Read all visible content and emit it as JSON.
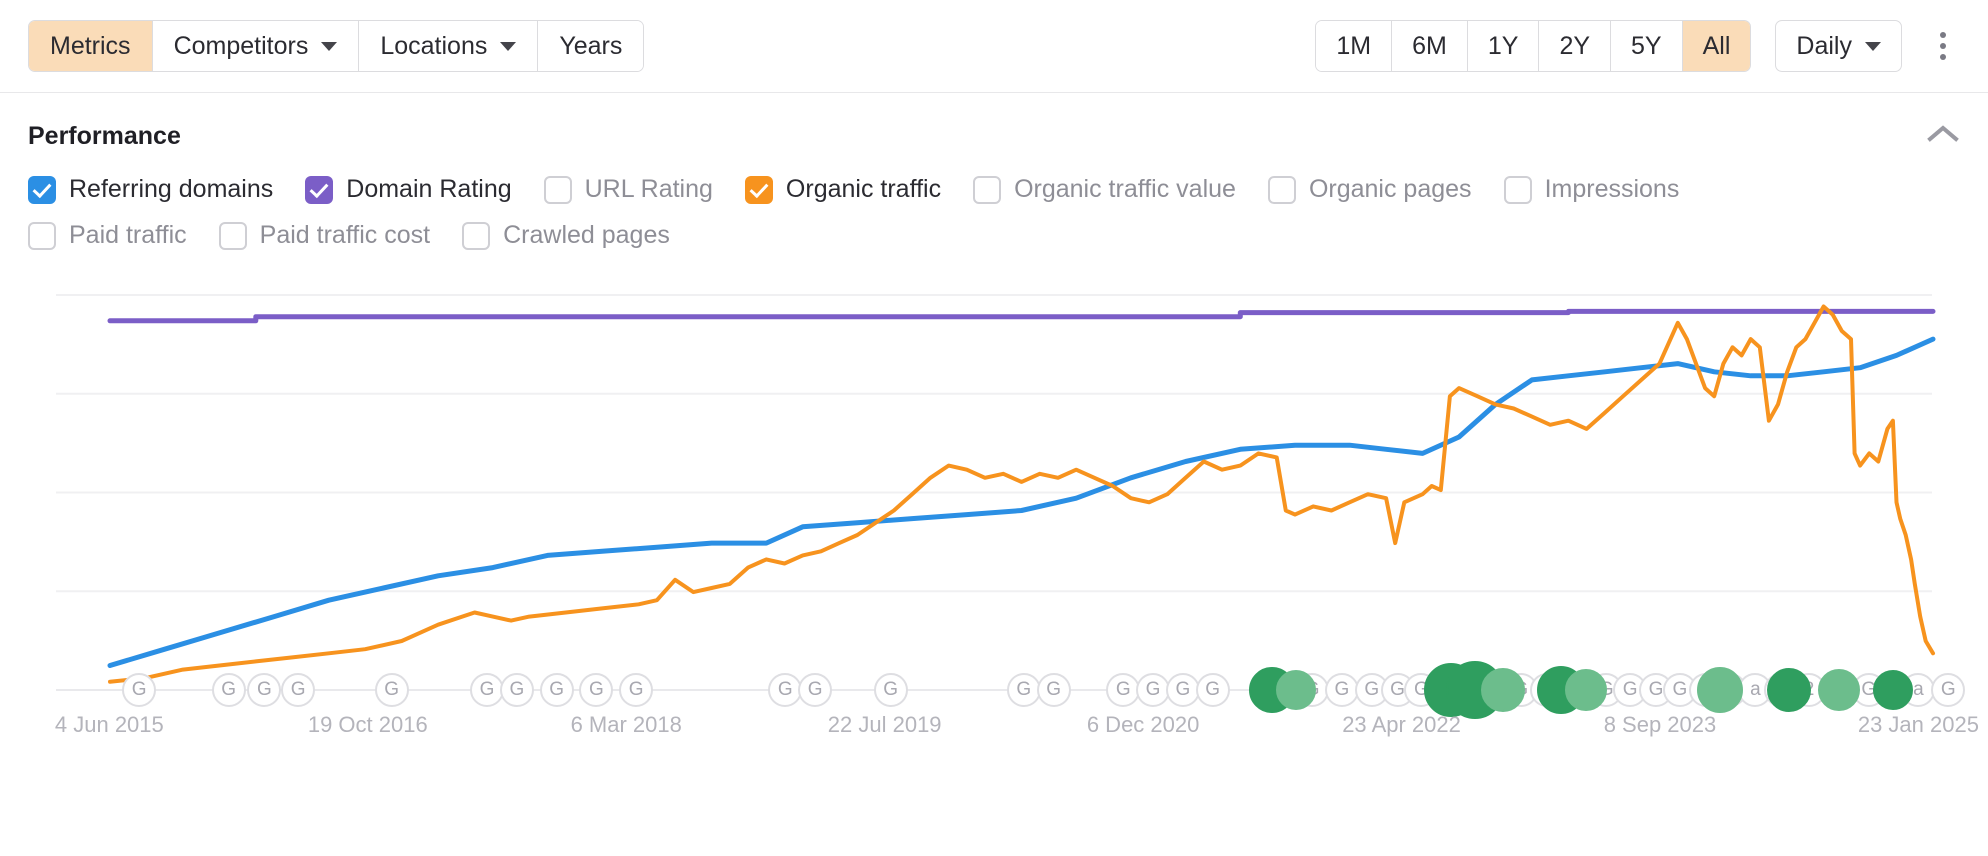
{
  "toolbar": {
    "tabs": [
      {
        "label": "Metrics",
        "active": true,
        "caret": false
      },
      {
        "label": "Competitors",
        "active": false,
        "caret": true
      },
      {
        "label": "Locations",
        "active": false,
        "caret": true
      },
      {
        "label": "Years",
        "active": false,
        "caret": false
      }
    ],
    "ranges": [
      {
        "label": "1M",
        "active": false
      },
      {
        "label": "6M",
        "active": false
      },
      {
        "label": "1Y",
        "active": false
      },
      {
        "label": "2Y",
        "active": false
      },
      {
        "label": "5Y",
        "active": false
      },
      {
        "label": "All",
        "active": true
      }
    ],
    "granularity": "Daily",
    "more_menu": "more-options"
  },
  "section": {
    "title": "Performance",
    "collapse": "collapse"
  },
  "metrics": {
    "row1": [
      {
        "label": "Referring domains",
        "checked": true,
        "color": "#2b8fe4"
      },
      {
        "label": "Domain Rating",
        "checked": true,
        "color": "#7b5ec7"
      },
      {
        "label": "URL Rating",
        "checked": false,
        "color": "#cfcfd4"
      },
      {
        "label": "Organic traffic",
        "checked": true,
        "color": "#f7931e"
      },
      {
        "label": "Organic traffic value",
        "checked": false,
        "color": "#cfcfd4"
      },
      {
        "label": "Organic pages",
        "checked": false,
        "color": "#cfcfd4"
      },
      {
        "label": "Impressions",
        "checked": false,
        "color": "#cfcfd4"
      }
    ],
    "row2": [
      {
        "label": "Paid traffic",
        "checked": false,
        "color": "#cfcfd4"
      },
      {
        "label": "Paid traffic cost",
        "checked": false,
        "color": "#cfcfd4"
      },
      {
        "label": "Crawled pages",
        "checked": false,
        "color": "#cfcfd4"
      }
    ]
  },
  "chart_data": {
    "type": "line",
    "title": "Performance",
    "xlabel": "",
    "ylabel": "",
    "grid": true,
    "legend": "top-checkboxes",
    "x_tick_labels": [
      "4 Jun 2015",
      "19 Oct 2016",
      "6 Mar 2018",
      "22 Jul 2019",
      "6 Dec 2020",
      "23 Apr 2022",
      "8 Sep 2023",
      "23 Jan 2025"
    ],
    "x_tick_positions_pct": [
      5.5,
      18.5,
      31.5,
      44.5,
      57.5,
      70.5,
      83.5,
      96.5
    ],
    "x_range": [
      "2015-06-04",
      "2025-01-23"
    ],
    "gridline_count": 5,
    "series": [
      {
        "name": "Referring domains",
        "color": "#2b8fe4",
        "unit": "domains",
        "points": [
          [
            0.0,
            0.06
          ],
          [
            0.03,
            0.1
          ],
          [
            0.06,
            0.14
          ],
          [
            0.09,
            0.18
          ],
          [
            0.12,
            0.22
          ],
          [
            0.15,
            0.25
          ],
          [
            0.18,
            0.28
          ],
          [
            0.21,
            0.3
          ],
          [
            0.24,
            0.33
          ],
          [
            0.27,
            0.34
          ],
          [
            0.3,
            0.35
          ],
          [
            0.33,
            0.36
          ],
          [
            0.36,
            0.36
          ],
          [
            0.38,
            0.4
          ],
          [
            0.41,
            0.41
          ],
          [
            0.44,
            0.42
          ],
          [
            0.47,
            0.43
          ],
          [
            0.5,
            0.44
          ],
          [
            0.53,
            0.47
          ],
          [
            0.56,
            0.52
          ],
          [
            0.59,
            0.56
          ],
          [
            0.62,
            0.59
          ],
          [
            0.65,
            0.6
          ],
          [
            0.68,
            0.6
          ],
          [
            0.7,
            0.59
          ],
          [
            0.72,
            0.58
          ],
          [
            0.74,
            0.62
          ],
          [
            0.76,
            0.7
          ],
          [
            0.78,
            0.76
          ],
          [
            0.8,
            0.77
          ],
          [
            0.82,
            0.78
          ],
          [
            0.84,
            0.79
          ],
          [
            0.86,
            0.8
          ],
          [
            0.88,
            0.78
          ],
          [
            0.9,
            0.77
          ],
          [
            0.92,
            0.77
          ],
          [
            0.94,
            0.78
          ],
          [
            0.96,
            0.79
          ],
          [
            0.98,
            0.82
          ],
          [
            1.0,
            0.86
          ]
        ]
      },
      {
        "name": "Domain Rating",
        "color": "#7b5ec7",
        "unit": "DR",
        "step": true,
        "points": [
          [
            0.0,
            0.905
          ],
          [
            0.08,
            0.905
          ],
          [
            0.08,
            0.915
          ],
          [
            0.62,
            0.915
          ],
          [
            0.62,
            0.925
          ],
          [
            0.8,
            0.925
          ],
          [
            0.8,
            0.928
          ],
          [
            1.0,
            0.928
          ]
        ]
      },
      {
        "name": "Organic traffic",
        "color": "#f7931e",
        "unit": "visits/mo",
        "points": [
          [
            0.0,
            0.02
          ],
          [
            0.02,
            0.03
          ],
          [
            0.04,
            0.05
          ],
          [
            0.06,
            0.06
          ],
          [
            0.08,
            0.07
          ],
          [
            0.1,
            0.08
          ],
          [
            0.12,
            0.09
          ],
          [
            0.14,
            0.1
          ],
          [
            0.16,
            0.12
          ],
          [
            0.18,
            0.16
          ],
          [
            0.2,
            0.19
          ],
          [
            0.21,
            0.18
          ],
          [
            0.22,
            0.17
          ],
          [
            0.23,
            0.18
          ],
          [
            0.25,
            0.19
          ],
          [
            0.27,
            0.2
          ],
          [
            0.29,
            0.21
          ],
          [
            0.3,
            0.22
          ],
          [
            0.31,
            0.27
          ],
          [
            0.32,
            0.24
          ],
          [
            0.33,
            0.25
          ],
          [
            0.34,
            0.26
          ],
          [
            0.35,
            0.3
          ],
          [
            0.36,
            0.32
          ],
          [
            0.37,
            0.31
          ],
          [
            0.38,
            0.33
          ],
          [
            0.39,
            0.34
          ],
          [
            0.4,
            0.36
          ],
          [
            0.41,
            0.38
          ],
          [
            0.42,
            0.41
          ],
          [
            0.43,
            0.44
          ],
          [
            0.44,
            0.48
          ],
          [
            0.45,
            0.52
          ],
          [
            0.46,
            0.55
          ],
          [
            0.47,
            0.54
          ],
          [
            0.48,
            0.52
          ],
          [
            0.49,
            0.53
          ],
          [
            0.5,
            0.51
          ],
          [
            0.51,
            0.53
          ],
          [
            0.52,
            0.52
          ],
          [
            0.53,
            0.54
          ],
          [
            0.54,
            0.52
          ],
          [
            0.55,
            0.5
          ],
          [
            0.56,
            0.47
          ],
          [
            0.57,
            0.46
          ],
          [
            0.58,
            0.48
          ],
          [
            0.59,
            0.52
          ],
          [
            0.6,
            0.56
          ],
          [
            0.61,
            0.54
          ],
          [
            0.62,
            0.55
          ],
          [
            0.63,
            0.58
          ],
          [
            0.64,
            0.57
          ],
          [
            0.645,
            0.44
          ],
          [
            0.65,
            0.43
          ],
          [
            0.66,
            0.45
          ],
          [
            0.67,
            0.44
          ],
          [
            0.68,
            0.46
          ],
          [
            0.69,
            0.48
          ],
          [
            0.7,
            0.47
          ],
          [
            0.705,
            0.36
          ],
          [
            0.71,
            0.46
          ],
          [
            0.72,
            0.48
          ],
          [
            0.725,
            0.5
          ],
          [
            0.73,
            0.49
          ],
          [
            0.735,
            0.72
          ],
          [
            0.74,
            0.74
          ],
          [
            0.75,
            0.72
          ],
          [
            0.76,
            0.7
          ],
          [
            0.77,
            0.69
          ],
          [
            0.78,
            0.67
          ],
          [
            0.79,
            0.65
          ],
          [
            0.8,
            0.66
          ],
          [
            0.81,
            0.64
          ],
          [
            0.82,
            0.68
          ],
          [
            0.83,
            0.72
          ],
          [
            0.84,
            0.76
          ],
          [
            0.85,
            0.8
          ],
          [
            0.86,
            0.9
          ],
          [
            0.865,
            0.86
          ],
          [
            0.87,
            0.8
          ],
          [
            0.875,
            0.74
          ],
          [
            0.88,
            0.72
          ],
          [
            0.885,
            0.8
          ],
          [
            0.89,
            0.84
          ],
          [
            0.895,
            0.82
          ],
          [
            0.9,
            0.86
          ],
          [
            0.905,
            0.84
          ],
          [
            0.91,
            0.66
          ],
          [
            0.915,
            0.7
          ],
          [
            0.92,
            0.78
          ],
          [
            0.925,
            0.84
          ],
          [
            0.93,
            0.86
          ],
          [
            0.935,
            0.9
          ],
          [
            0.94,
            0.94
          ],
          [
            0.945,
            0.92
          ],
          [
            0.95,
            0.88
          ],
          [
            0.955,
            0.86
          ],
          [
            0.957,
            0.58
          ],
          [
            0.96,
            0.55
          ],
          [
            0.965,
            0.58
          ],
          [
            0.97,
            0.56
          ],
          [
            0.975,
            0.64
          ],
          [
            0.978,
            0.66
          ],
          [
            0.98,
            0.46
          ],
          [
            0.982,
            0.42
          ],
          [
            0.985,
            0.38
          ],
          [
            0.988,
            0.32
          ],
          [
            0.99,
            0.26
          ],
          [
            0.993,
            0.18
          ],
          [
            0.996,
            0.12
          ],
          [
            1.0,
            0.09
          ]
        ]
      }
    ],
    "event_markers": {
      "description": "Google algorithm update badges on the x-axis baseline",
      "items": [
        {
          "x": 7.0,
          "glyph": "G",
          "style": "gray",
          "size": 34
        },
        {
          "x": 11.5,
          "glyph": "G",
          "style": "gray",
          "size": 34
        },
        {
          "x": 13.3,
          "glyph": "G",
          "style": "gray",
          "size": 34
        },
        {
          "x": 15.0,
          "glyph": "G",
          "style": "gray",
          "size": 34
        },
        {
          "x": 19.7,
          "glyph": "G",
          "style": "gray",
          "size": 34
        },
        {
          "x": 24.5,
          "glyph": "G",
          "style": "gray",
          "size": 34
        },
        {
          "x": 26.0,
          "glyph": "G",
          "style": "gray",
          "size": 34
        },
        {
          "x": 28.0,
          "glyph": "G",
          "style": "gray",
          "size": 34
        },
        {
          "x": 30.0,
          "glyph": "G",
          "style": "gray",
          "size": 34
        },
        {
          "x": 32.0,
          "glyph": "G",
          "style": "gray",
          "size": 34
        },
        {
          "x": 39.5,
          "glyph": "G",
          "style": "gray",
          "size": 34
        },
        {
          "x": 41.0,
          "glyph": "G",
          "style": "gray",
          "size": 34
        },
        {
          "x": 44.8,
          "glyph": "G",
          "style": "gray",
          "size": 34
        },
        {
          "x": 51.5,
          "glyph": "G",
          "style": "gray",
          "size": 34
        },
        {
          "x": 53.0,
          "glyph": "G",
          "style": "gray",
          "size": 34
        },
        {
          "x": 56.5,
          "glyph": "G",
          "style": "gray",
          "size": 34
        },
        {
          "x": 58.0,
          "glyph": "G",
          "style": "gray",
          "size": 34
        },
        {
          "x": 59.5,
          "glyph": "G",
          "style": "gray",
          "size": 34
        },
        {
          "x": 61.0,
          "glyph": "G",
          "style": "gray",
          "size": 34
        },
        {
          "x": 64.5,
          "glyph": "G",
          "style": "gray",
          "size": 34
        },
        {
          "x": 66.0,
          "glyph": "G",
          "style": "gray",
          "size": 34
        },
        {
          "x": 67.5,
          "glyph": "G",
          "style": "gray",
          "size": 34
        },
        {
          "x": 69.0,
          "glyph": "G",
          "style": "gray",
          "size": 34
        },
        {
          "x": 70.3,
          "glyph": "G",
          "style": "gray",
          "size": 34
        },
        {
          "x": 71.5,
          "glyph": "G",
          "style": "gray",
          "size": 34
        },
        {
          "x": 72.7,
          "glyph": "G",
          "style": "gray",
          "size": 34
        },
        {
          "x": 74.0,
          "glyph": "a",
          "style": "gray",
          "size": 34
        },
        {
          "x": 76.5,
          "glyph": "G",
          "style": "gray",
          "size": 34
        },
        {
          "x": 77.8,
          "glyph": "G",
          "style": "gray",
          "size": 34
        },
        {
          "x": 79.5,
          "glyph": "G",
          "style": "gray",
          "size": 34
        },
        {
          "x": 80.8,
          "glyph": "G",
          "style": "gray",
          "size": 34
        },
        {
          "x": 82.0,
          "glyph": "G",
          "style": "gray",
          "size": 34
        },
        {
          "x": 83.3,
          "glyph": "G",
          "style": "gray",
          "size": 34
        },
        {
          "x": 84.5,
          "glyph": "G",
          "style": "gray",
          "size": 34
        },
        {
          "x": 85.8,
          "glyph": "G",
          "style": "gray",
          "size": 34
        },
        {
          "x": 87.0,
          "glyph": "G",
          "style": "gray",
          "size": 34
        },
        {
          "x": 88.3,
          "glyph": "a",
          "style": "gray",
          "size": 34
        },
        {
          "x": 89.6,
          "glyph": "G",
          "style": "gray",
          "size": 34
        },
        {
          "x": 91.0,
          "glyph": "2",
          "style": "gray",
          "size": 34
        },
        {
          "x": 94.0,
          "glyph": "G",
          "style": "gray",
          "size": 34
        },
        {
          "x": 96.5,
          "glyph": "a",
          "style": "gray",
          "size": 34
        },
        {
          "x": 98.0,
          "glyph": "G",
          "style": "gray",
          "size": 34
        },
        {
          "x": 64.0,
          "glyph": "",
          "style": "green",
          "size": 46
        },
        {
          "x": 65.2,
          "glyph": "",
          "style": "greenlite",
          "size": 40
        },
        {
          "x": 73.0,
          "glyph": "",
          "style": "green",
          "size": 54
        },
        {
          "x": 74.2,
          "glyph": "",
          "style": "green",
          "size": 58
        },
        {
          "x": 75.6,
          "glyph": "",
          "style": "greenlite",
          "size": 44
        },
        {
          "x": 78.5,
          "glyph": "",
          "style": "green",
          "size": 48
        },
        {
          "x": 79.8,
          "glyph": "",
          "style": "greenlite",
          "size": 42
        },
        {
          "x": 86.5,
          "glyph": "",
          "style": "greenlite",
          "size": 46
        },
        {
          "x": 90.0,
          "glyph": "",
          "style": "green",
          "size": 44
        },
        {
          "x": 92.5,
          "glyph": "",
          "style": "greenlite",
          "size": 42
        },
        {
          "x": 95.2,
          "glyph": "",
          "style": "green",
          "size": 40
        }
      ]
    }
  }
}
